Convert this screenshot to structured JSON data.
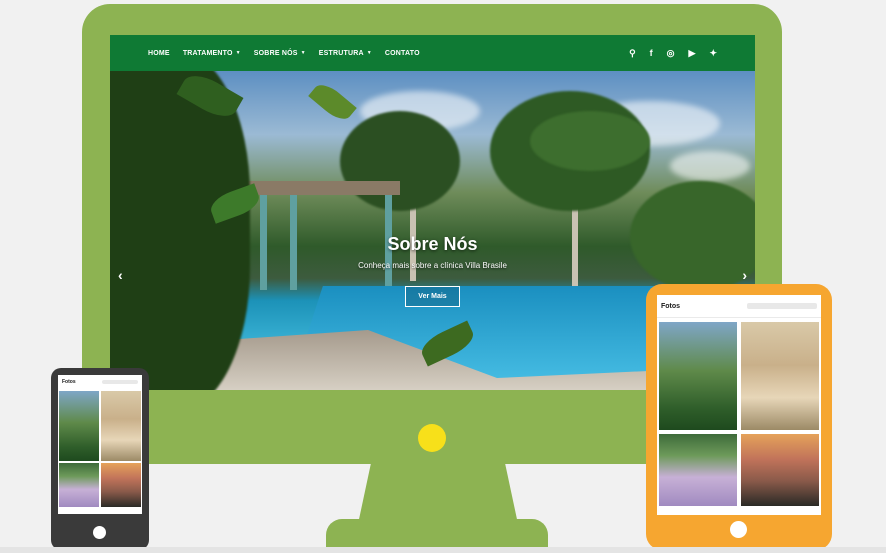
{
  "nav": {
    "items": [
      {
        "label": "HOME",
        "has_dropdown": false
      },
      {
        "label": "TRATAMENTO",
        "has_dropdown": true
      },
      {
        "label": "SOBRE NÓS",
        "has_dropdown": true
      },
      {
        "label": "ESTRUTURA",
        "has_dropdown": true
      },
      {
        "label": "CONTATO",
        "has_dropdown": false
      }
    ],
    "caret_glyph": "▼",
    "icons": [
      {
        "name": "search-icon",
        "glyph": "⚲"
      },
      {
        "name": "facebook-icon",
        "glyph": "f"
      },
      {
        "name": "instagram-icon",
        "glyph": "◎"
      },
      {
        "name": "youtube-icon",
        "glyph": "▶"
      },
      {
        "name": "twitter-icon",
        "glyph": "✦"
      }
    ],
    "background": "#0f7a34"
  },
  "hero": {
    "title": "Sobre Nós",
    "subtitle": "Conheça mais sobre a clínica Villa Brasile",
    "button_label": "Ver Mais",
    "prev_arrow": "‹",
    "next_arrow": "›"
  },
  "tablet": {
    "page_title": "Fotos"
  },
  "phone": {
    "page_title": "Fotos"
  },
  "colors": {
    "monitor": "#8db352",
    "monitor_button": "#f7e01a",
    "tablet": "#f6a630",
    "phone": "#3a3a3a",
    "background": "#f1f1f1"
  }
}
